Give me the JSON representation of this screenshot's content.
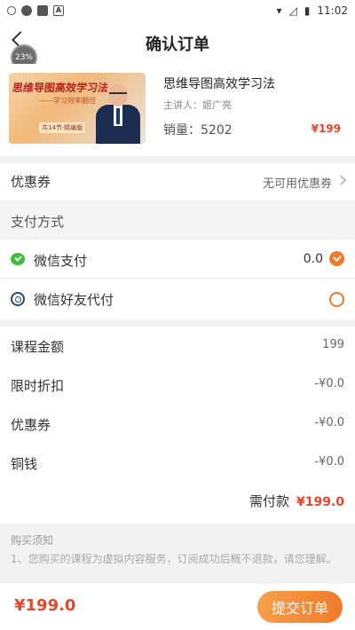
{
  "status_bar": {
    "time": "11:02"
  },
  "header": {
    "title": "确认订单",
    "progress_badge": "23%"
  },
  "course": {
    "thumbnail": {
      "title": "思维导图高效学习法",
      "subtitle": "——学习效率翻倍",
      "tag": "共14节·精编版"
    },
    "name": "思维导图高效学习法",
    "lecturer": "主讲人：姬广亮",
    "sales": "销量：5202",
    "price": "¥199"
  },
  "coupon": {
    "label": "优惠券",
    "value": "无可用优惠券"
  },
  "payment": {
    "section_title": "支付方式",
    "methods": [
      {
        "label": "微信支付",
        "amount": "0.0",
        "selected": true
      },
      {
        "label": "微信好友代付",
        "amount": "",
        "selected": false
      }
    ]
  },
  "summary": {
    "rows": [
      {
        "label": "课程金额",
        "value": "199"
      },
      {
        "label": "限时折扣",
        "value": "-¥0.0"
      },
      {
        "label": "优惠券",
        "value": "-¥0.0"
      },
      {
        "label": "铜钱",
        "value": "-¥0.0"
      }
    ],
    "need_pay_label": "需付款",
    "need_pay_value": "¥199.0"
  },
  "notice": {
    "title": "购买须知",
    "text": "1、您购买的课程为虚拟内容服务，订阅成功后概不退款，请您理解。"
  },
  "bottom": {
    "total": "¥199.0",
    "submit_label": "提交订单"
  },
  "colors": {
    "accent": "#f07a2a",
    "price": "#e8452c",
    "wechat": "#3dbb3d"
  }
}
